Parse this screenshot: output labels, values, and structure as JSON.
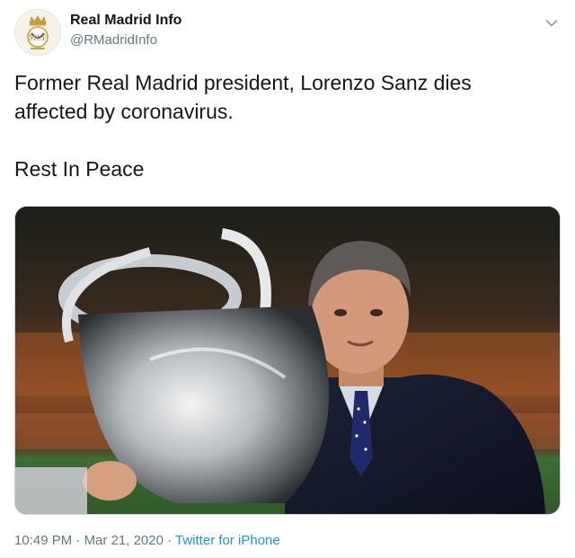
{
  "author": {
    "display_name": "Real Madrid Info",
    "handle": "@RMadridInfo",
    "avatar_icon": "real-madrid-crest-icon"
  },
  "menu_icon": "chevron-down-icon",
  "tweet": {
    "text": "Former Real Madrid president, Lorenzo Sanz dies\naffected by  coronavirus.\n\nRest In Peace"
  },
  "media": {
    "description_icon": "photo-man-with-trophy"
  },
  "meta": {
    "time": "10:49 PM",
    "separator1": " · ",
    "date": "Mar 21, 2020",
    "separator2": " · ",
    "source": "Twitter for iPhone"
  },
  "colors": {
    "text": "#14171a",
    "secondary": "#657786",
    "link": "#1b95e0",
    "border": "#ccd6dd"
  }
}
